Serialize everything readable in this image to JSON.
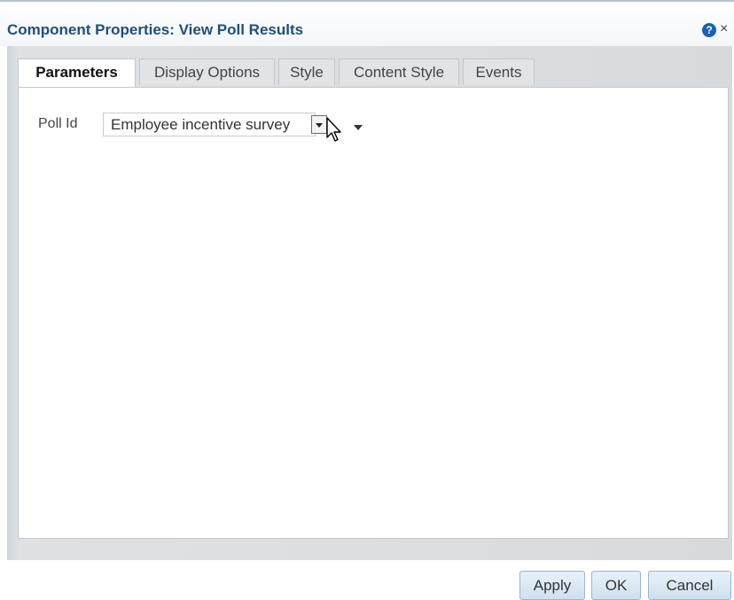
{
  "dialog": {
    "title": "Component Properties: View Poll Results",
    "help_glyph": "?",
    "close_glyph": "×"
  },
  "tabs": [
    {
      "label": "Parameters",
      "active": true
    },
    {
      "label": "Display Options",
      "active": false
    },
    {
      "label": "Style",
      "active": false
    },
    {
      "label": "Content Style",
      "active": false
    },
    {
      "label": "Events",
      "active": false
    }
  ],
  "parameters": {
    "poll_id_label": "Poll Id",
    "poll_id_value": "Employee incentive survey"
  },
  "footer": {
    "apply_label": "Apply",
    "ok_label": "OK",
    "cancel_label": "Cancel"
  },
  "icons": {
    "help": "help-icon",
    "close": "close-icon",
    "dropdown": "chevron-down-icon",
    "cursor": "mouse-pointer-icon"
  },
  "colors": {
    "title": "#1f4e79",
    "help_icon": "#1b5fb8",
    "button_bg": "#d9e7f4",
    "button_border": "#9db5cc",
    "panel_bg": "#d8dbde"
  }
}
